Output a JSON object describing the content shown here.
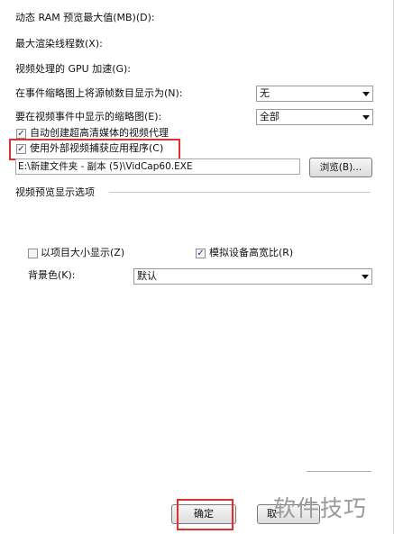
{
  "labels": {
    "max_preview_ram": "动态 RAM 预览最大值(MB)(D):",
    "max_render_threads": "最大渲染线程数(X):",
    "gpu_accel": "视频处理的 GPU 加速(G):",
    "thumb_frames": "在事件缩略图上将源帧数目显示为(N):",
    "thumbs_to_show": "要在视频事件中显示的缩略图(E):",
    "video_preview_options": "视频预览显示选项",
    "bg_color": "背景色(K):"
  },
  "combos": {
    "thumb_frames_value": "无",
    "thumbs_to_show_value": "全部",
    "bg_color_value": "默认"
  },
  "checkboxes": {
    "auto_proxy": "自动创建超高清媒体的视频代理",
    "use_external_capture": "使用外部视频捕获应用程序(C)",
    "show_at_size": "以项目大小显示(Z)",
    "simulate_aspect": "模拟设备高宽比(R)"
  },
  "capture_path": "E:\\新建文件夹 - 副本 (5)\\VidCap60.EXE",
  "buttons": {
    "browse": "浏览(B)...",
    "ok": "确定",
    "cancel_partial": "取"
  },
  "watermark": "软件技巧"
}
